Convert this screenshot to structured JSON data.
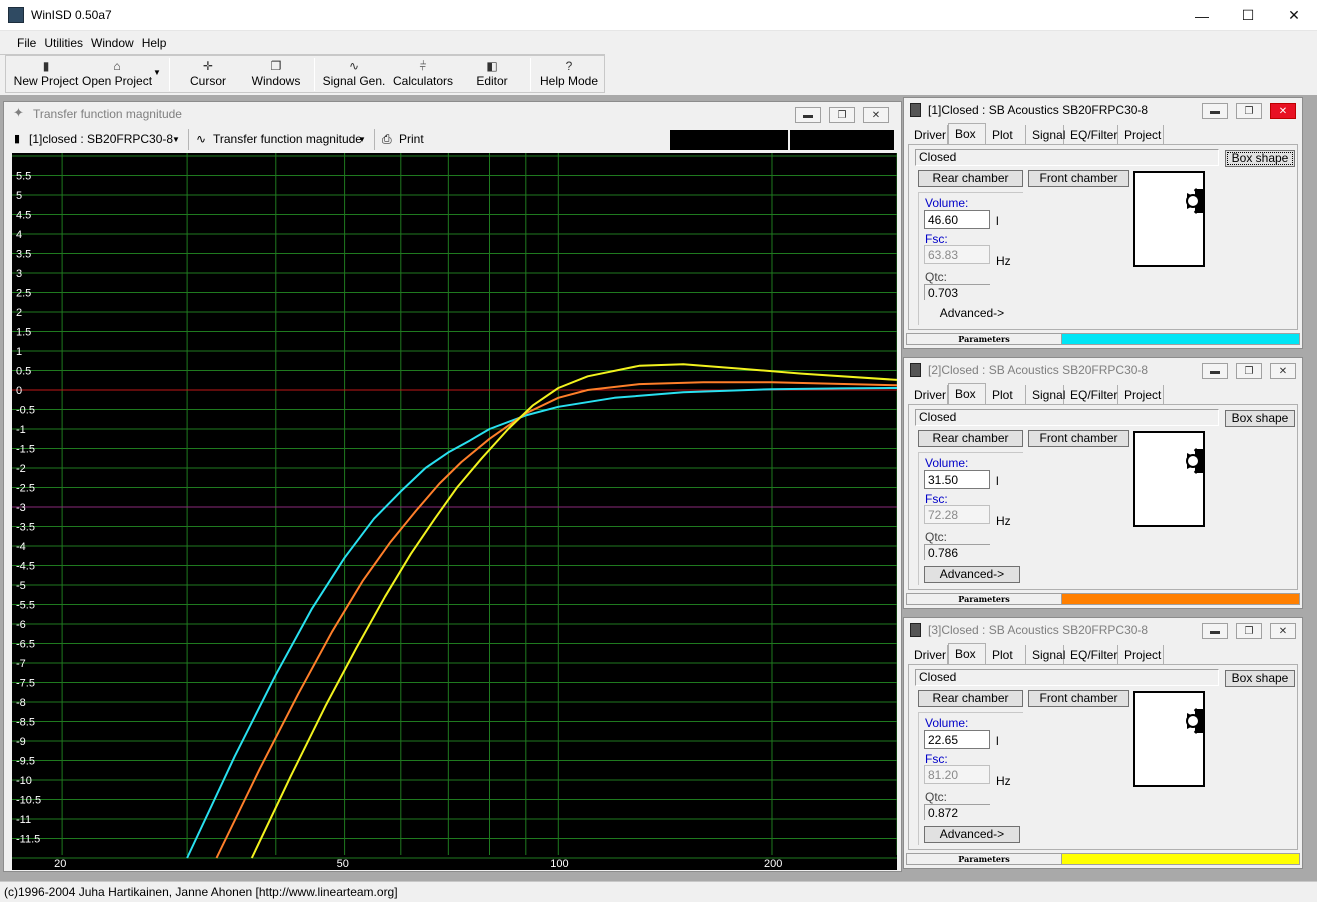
{
  "app": {
    "title": "WinISD 0.50a7",
    "colors": {
      "mdi_bg": "#a9a9a9"
    }
  },
  "window_controls": {
    "minimize": "—",
    "maximize": "☐",
    "close": "✕"
  },
  "menu": [
    "File",
    "Utilities",
    "Window",
    "Help"
  ],
  "toolbar": {
    "new_project": "New Project",
    "open_project": "Open Project",
    "cursor": "Cursor",
    "windows": "Windows",
    "signal_gen": "Signal Gen.",
    "calculators": "Calculators",
    "editor": "Editor",
    "help_mode": "Help Mode"
  },
  "chart_window": {
    "title": "Transfer function magnitude",
    "project_select": "[1]closed : SB20FRPC30-8",
    "graph_select": "Transfer function magnitude",
    "print": "Print"
  },
  "chart_data": {
    "type": "line",
    "x_scale": "log",
    "xlim": [
      17,
      300
    ],
    "ylim": [
      -12,
      6
    ],
    "x_ticks": [
      20,
      50,
      100,
      200
    ],
    "x_tick_labels": [
      "20",
      "50",
      "100",
      "200"
    ],
    "y_tick_labels": [
      "5.5",
      "5",
      "4.5",
      "4",
      "3.5",
      "3",
      "2.5",
      "2",
      "1.5",
      "1",
      "0.5",
      "0",
      "-0.5",
      "-1",
      "-1.5",
      "-2",
      "-2.5",
      "-3",
      "-3.5",
      "-4",
      "-4.5",
      "-5",
      "-5.5",
      "-6",
      "-6.5",
      "-7",
      "-7.5",
      "-8",
      "-8.5",
      "-9",
      "-9.5",
      "-10",
      "-10.5",
      "-11",
      "-11.5"
    ],
    "grid": true,
    "colors": {
      "background": "#000000",
      "grid": "#1f7a1f",
      "zero_line": "#c01818",
      "minus3_line": "#8a2a7a",
      "tick_text": "#ffffff"
    },
    "series": [
      {
        "color": "#29e0f0",
        "fc": 63.83,
        "q": 0.703,
        "points": [
          [
            30,
            -12.0
          ],
          [
            35,
            -9.4
          ],
          [
            40,
            -7.3
          ],
          [
            45,
            -5.6
          ],
          [
            50,
            -4.3
          ],
          [
            55,
            -3.3
          ],
          [
            60,
            -2.6
          ],
          [
            65,
            -2.0
          ],
          [
            70,
            -1.6
          ],
          [
            75,
            -1.3
          ],
          [
            80,
            -1.0
          ],
          [
            90,
            -0.65
          ],
          [
            100,
            -0.43
          ],
          [
            120,
            -0.2
          ],
          [
            150,
            -0.06
          ],
          [
            200,
            0.02
          ],
          [
            250,
            0.04
          ],
          [
            300,
            0.05
          ]
        ]
      },
      {
        "color": "#ff7f2a",
        "fc": 72.28,
        "q": 0.786,
        "points": [
          [
            33,
            -12.0
          ],
          [
            38,
            -9.7
          ],
          [
            43,
            -7.8
          ],
          [
            48,
            -6.2
          ],
          [
            53,
            -4.9
          ],
          [
            58,
            -3.9
          ],
          [
            63,
            -3.1
          ],
          [
            68,
            -2.4
          ],
          [
            73,
            -1.85
          ],
          [
            80,
            -1.25
          ],
          [
            90,
            -0.6
          ],
          [
            100,
            -0.2
          ],
          [
            110,
            0.0
          ],
          [
            130,
            0.15
          ],
          [
            160,
            0.2
          ],
          [
            200,
            0.2
          ],
          [
            300,
            0.12
          ]
        ]
      },
      {
        "color": "#f2f21e",
        "fc": 81.2,
        "q": 0.872,
        "points": [
          [
            37,
            -12.0
          ],
          [
            42,
            -9.9
          ],
          [
            47,
            -8.1
          ],
          [
            52,
            -6.6
          ],
          [
            57,
            -5.3
          ],
          [
            62,
            -4.2
          ],
          [
            67,
            -3.3
          ],
          [
            72,
            -2.5
          ],
          [
            78,
            -1.75
          ],
          [
            85,
            -1.0
          ],
          [
            92,
            -0.4
          ],
          [
            100,
            0.05
          ],
          [
            110,
            0.35
          ],
          [
            130,
            0.62
          ],
          [
            150,
            0.66
          ],
          [
            180,
            0.55
          ],
          [
            220,
            0.42
          ],
          [
            300,
            0.26
          ]
        ]
      }
    ]
  },
  "side_windows": [
    {
      "title": "[1]Closed : SB Acoustics SB20FRPC30-8",
      "tabs": [
        "Driver",
        "Box",
        "Plot",
        "Signal",
        "EQ/Filter",
        "Project"
      ],
      "active_tab": "Box",
      "box_type": "Closed",
      "box_shape_btn": "Box shape",
      "rear_btn": "Rear chamber",
      "front_btn": "Front chamber",
      "volume_label": "Volume:",
      "volume": "46.60",
      "volume_unit": "l",
      "fsc_label": "Fsc:",
      "fsc": "63.83",
      "fsc_unit": "Hz",
      "qtc_label": "Qtc:",
      "qtc": "0.703",
      "advanced": "Advanced->",
      "params_label": "Parameters",
      "color": "#00e5f5"
    },
    {
      "title": "[2]Closed : SB Acoustics SB20FRPC30-8",
      "tabs": [
        "Driver",
        "Box",
        "Plot",
        "Signal",
        "EQ/Filter",
        "Project"
      ],
      "active_tab": "Box",
      "box_type": "Closed",
      "box_shape_btn": "Box shape",
      "rear_btn": "Rear chamber",
      "front_btn": "Front chamber",
      "volume_label": "Volume:",
      "volume": "31.50",
      "volume_unit": "l",
      "fsc_label": "Fsc:",
      "fsc": "72.28",
      "fsc_unit": "Hz",
      "qtc_label": "Qtc:",
      "qtc": "0.786",
      "advanced": "Advanced->",
      "params_label": "Parameters",
      "color": "#ff7f00"
    },
    {
      "title": "[3]Closed : SB Acoustics SB20FRPC30-8",
      "tabs": [
        "Driver",
        "Box",
        "Plot",
        "Signal",
        "EQ/Filter",
        "Project"
      ],
      "active_tab": "Box",
      "box_type": "Closed",
      "box_shape_btn": "Box shape",
      "rear_btn": "Rear chamber",
      "front_btn": "Front chamber",
      "volume_label": "Volume:",
      "volume": "22.65",
      "volume_unit": "l",
      "fsc_label": "Fsc:",
      "fsc": "81.20",
      "fsc_unit": "Hz",
      "qtc_label": "Qtc:",
      "qtc": "0.872",
      "advanced": "Advanced->",
      "params_label": "Parameters",
      "color": "#ffff00"
    }
  ],
  "status": "(c)1996-2004 Juha Hartikainen, Janne Ahonen [http://www.linearteam.org]"
}
